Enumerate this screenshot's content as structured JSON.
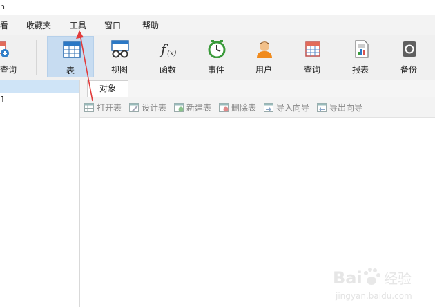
{
  "window": {
    "title_fragment": "n"
  },
  "menu": {
    "items": [
      {
        "label": "看"
      },
      {
        "label": "收藏夹"
      },
      {
        "label": "工具"
      },
      {
        "label": "窗口"
      },
      {
        "label": "帮助"
      }
    ]
  },
  "toolbar": {
    "items": [
      {
        "label": "查询",
        "icon": "query-table-plus-icon",
        "active": false
      },
      {
        "label": "表",
        "icon": "table-icon",
        "active": true
      },
      {
        "label": "视图",
        "icon": "view-glasses-icon",
        "active": false
      },
      {
        "label": "函数",
        "icon": "function-fx-icon",
        "active": false
      },
      {
        "label": "事件",
        "icon": "clock-icon",
        "active": false
      },
      {
        "label": "用户",
        "icon": "user-icon",
        "active": false
      },
      {
        "label": "查询",
        "icon": "query-icon",
        "active": false
      },
      {
        "label": "报表",
        "icon": "report-icon",
        "active": false
      },
      {
        "label": "备份",
        "icon": "backup-icon",
        "active": false
      }
    ]
  },
  "left_pane": {
    "item_fragment": "1"
  },
  "object_tab": {
    "label": "对象"
  },
  "object_toolbar": {
    "items": [
      {
        "label": "打开表",
        "icon": "open-table-icon"
      },
      {
        "label": "设计表",
        "icon": "design-table-icon"
      },
      {
        "label": "新建表",
        "icon": "new-table-icon"
      },
      {
        "label": "删除表",
        "icon": "delete-table-icon"
      },
      {
        "label": "导入向导",
        "icon": "import-wizard-icon"
      },
      {
        "label": "导出向导",
        "icon": "export-wizard-icon"
      }
    ]
  },
  "annotation": {
    "color": "#e23b3b"
  },
  "watermark": {
    "brand": "Bai",
    "brand_suffix": "经验",
    "url": "jingyan.baidu.com"
  }
}
